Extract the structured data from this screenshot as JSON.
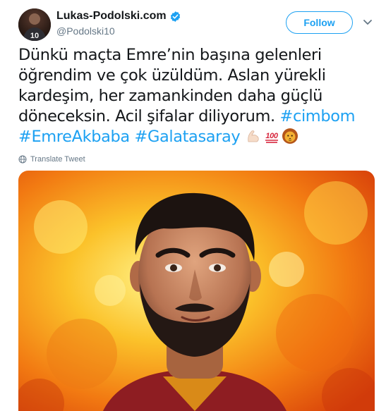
{
  "author": {
    "display_name": "Lukas-Podolski.com",
    "handle": "@Podolski10",
    "verified": true,
    "avatar_jersey_number": "10"
  },
  "actions": {
    "follow_label": "Follow",
    "menu_icon": "chevron-down-icon"
  },
  "tweet": {
    "lines": [
      [
        {
          "t": "Dünkü maçta Emre’nin başına gelenleri"
        }
      ],
      [
        {
          "t": "öğrendim ve çok üzüldüm. Aslan yürekli"
        }
      ],
      [
        {
          "t": "kardeşim, her zamankinden daha güçlü"
        }
      ],
      [
        {
          "t": "döneceksin. Acil şifalar diliyorum. "
        },
        {
          "t": "#cimbom",
          "tag": true
        }
      ],
      [
        {
          "t": "#EmreAkbaba",
          "tag": true
        },
        {
          "t": " "
        },
        {
          "t": "#Galatasaray",
          "tag": true
        },
        {
          "t": " "
        }
      ]
    ],
    "emojis": [
      "flexed-biceps-emoji",
      "hundred-points-emoji",
      "lion-face-emoji"
    ]
  },
  "translate": {
    "label": "Translate Tweet",
    "icon": "globe-icon"
  },
  "media": {
    "type": "image",
    "subject": "illustrated-player-portrait"
  },
  "colors": {
    "accent": "#1da1f2",
    "text": "#14171a",
    "secondary": "#657786"
  }
}
